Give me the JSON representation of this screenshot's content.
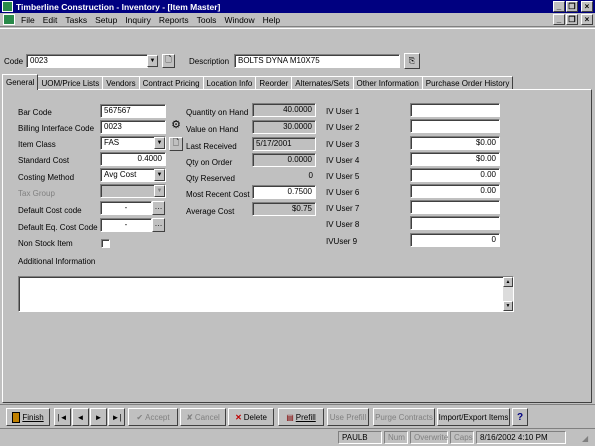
{
  "window": {
    "title": "Timberline Construction - Inventory - [Item Master]"
  },
  "menu": [
    "File",
    "Edit",
    "Tasks",
    "Setup",
    "Inquiry",
    "Reports",
    "Tools",
    "Window",
    "Help"
  ],
  "header": {
    "code_label": "Code",
    "code_value": "0023",
    "description_label": "Description",
    "description_value": "BOLTS DYNA M10X75"
  },
  "tabs": [
    "General",
    "UOM/Price Lists",
    "Vendors",
    "Contract Pricing",
    "Location Info",
    "Reorder",
    "Alternates/Sets",
    "Other Information",
    "Purchase Order History"
  ],
  "general": {
    "bar_code_label": "Bar Code",
    "bar_code": "567567",
    "billing_label": "Billing Interface Code",
    "billing": "0023",
    "item_class_label": "Item Class",
    "item_class": "FAS",
    "standard_cost_label": "Standard Cost",
    "standard_cost": "0.4000",
    "costing_method_label": "Costing Method",
    "costing_method": "Avg Cost",
    "tax_group_label": "Tax Group",
    "tax_group": "",
    "default_cost_code_label": "Default Cost code",
    "default_cost_code": "-",
    "default_eq_cost_code_label": "Default Eq. Cost Code",
    "default_eq_cost_code": "-",
    "non_stock_label": "Non Stock Item",
    "additional_info_label": "Additional Information",
    "qty_on_hand_label": "Quantity on Hand",
    "qty_on_hand": "40.0000",
    "value_on_hand_label": "Value on Hand",
    "value_on_hand": "30.0000",
    "last_received_label": "Last Received",
    "last_received": "5/17/2001",
    "qty_on_order_label": "Qty on Order",
    "qty_on_order": "0.0000",
    "qty_reserved_label": "Qty Reserved",
    "qty_reserved": "0",
    "most_recent_cost_label": "Most Recent Cost",
    "most_recent_cost": "0.7500",
    "average_cost_label": "Average Cost",
    "average_cost": "$0.75"
  },
  "iv_users": [
    {
      "label": "IV User 1",
      "value": ""
    },
    {
      "label": "IV User 2",
      "value": ""
    },
    {
      "label": "IV User 3",
      "value": "$0.00"
    },
    {
      "label": "IV User 4",
      "value": "$0.00"
    },
    {
      "label": "IV User 5",
      "value": "0.00"
    },
    {
      "label": "IV User 6",
      "value": "0.00"
    },
    {
      "label": "IV User 7",
      "value": ""
    },
    {
      "label": "IV User 8",
      "value": ""
    },
    {
      "label": "IVUser 9",
      "value": "0"
    }
  ],
  "toolbar": {
    "finish": "Finish",
    "accept": "Accept",
    "cancel": "Cancel",
    "delete": "Delete",
    "prefill": "Prefill",
    "use_prefill": "Use Prefill",
    "purge": "Purge Contracts",
    "import_export": "Import/Export Items",
    "help": "?",
    "first": "|◄",
    "prev": "◄",
    "next": "►",
    "last": "►|"
  },
  "status": {
    "user": "PAULB",
    "num": "Num",
    "overwrite": "Overwrite",
    "caps": "Caps",
    "datetime": "8/16/2002  4:10 PM"
  },
  "colors": {
    "titlebar": "#000080",
    "face": "#c0c0c0",
    "field": "#ffffff"
  }
}
